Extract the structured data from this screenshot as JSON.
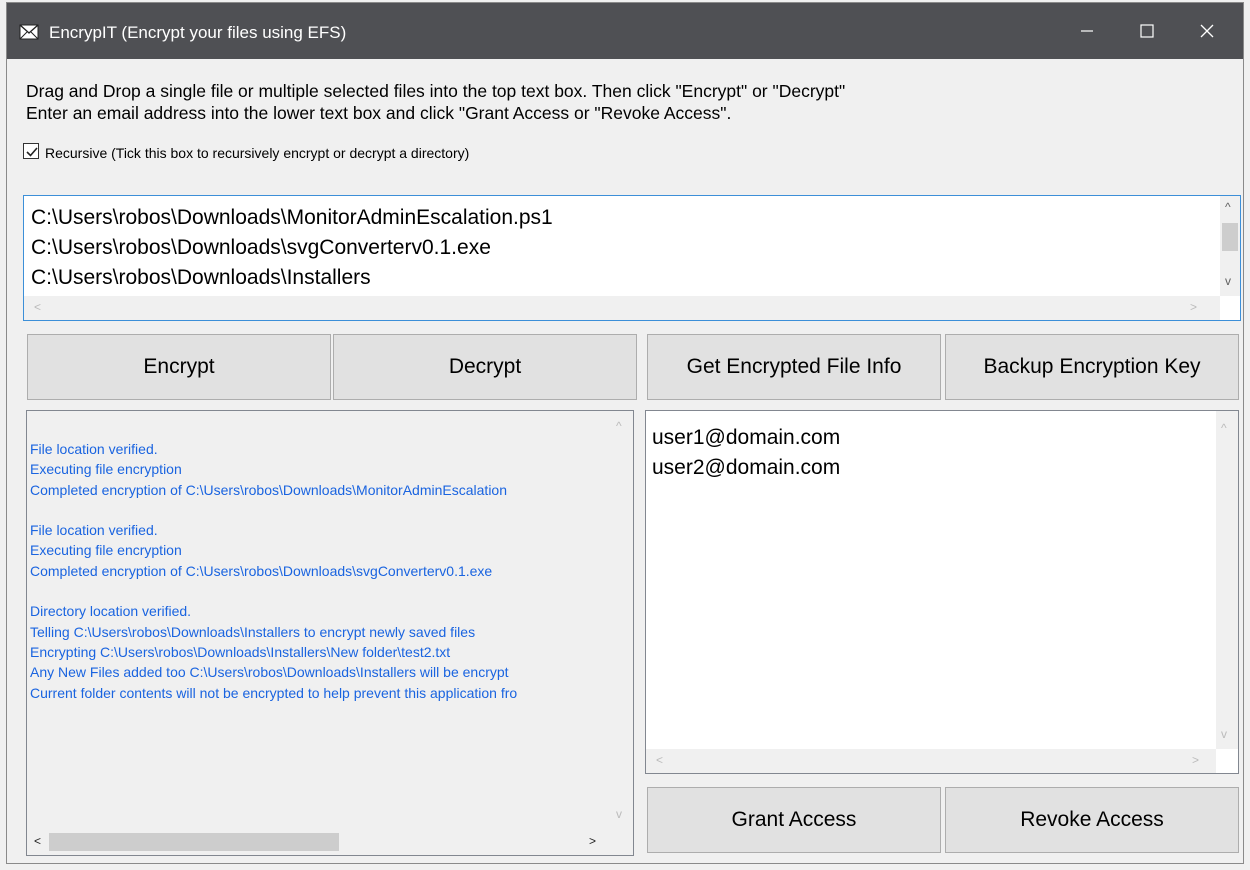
{
  "window": {
    "title": "EncrypIT (Encrypt your files using EFS)",
    "app_icon": "envelope-shield-icon",
    "controls": [
      "minimize-icon",
      "maximize-icon",
      "close-icon"
    ]
  },
  "instructions": {
    "line1": "Drag and Drop a single file or multiple selected files into the top text box. Then click \"Encrypt\" or \"Decrypt\"",
    "line2": "Enter an email address into the lower text box and click \"Grant Access or \"Revoke Access\"."
  },
  "recursive": {
    "checked": true,
    "label": "Recursive (Tick this box to recursively encrypt or decrypt a directory)"
  },
  "files": [
    "C:\\Users\\robos\\Downloads\\MonitorAdminEscalation.ps1",
    "C:\\Users\\robos\\Downloads\\svgConverterv0.1.exe",
    "C:\\Users\\robos\\Downloads\\Installers"
  ],
  "buttons": {
    "encrypt": "Encrypt",
    "decrypt": "Decrypt",
    "get_info": "Get Encrypted File Info",
    "backup_key": "Backup Encryption Key",
    "grant": "Grant Access",
    "revoke": "Revoke Access"
  },
  "log": [
    "File location verified.",
    "Executing file encryption",
    "Completed encryption of C:\\Users\\robos\\Downloads\\MonitorAdminEscalation",
    "",
    "File location verified.",
    "Executing file encryption",
    "Completed encryption of C:\\Users\\robos\\Downloads\\svgConverterv0.1.exe",
    "",
    "Directory location verified.",
    "Telling C:\\Users\\robos\\Downloads\\Installers to encrypt newly saved files",
    "Encrypting C:\\Users\\robos\\Downloads\\Installers\\New folder\\test2.txt",
    "Any New Files added too C:\\Users\\robos\\Downloads\\Installers will be encrypt",
    "Current folder contents will not be encrypted to help prevent this application fro"
  ],
  "emails": [
    "user1@domain.com",
    "user2@domain.com"
  ],
  "colors": {
    "titlebar": "#4f5054",
    "log_text": "#1a64e0",
    "focus_border": "#3c8fd8"
  }
}
